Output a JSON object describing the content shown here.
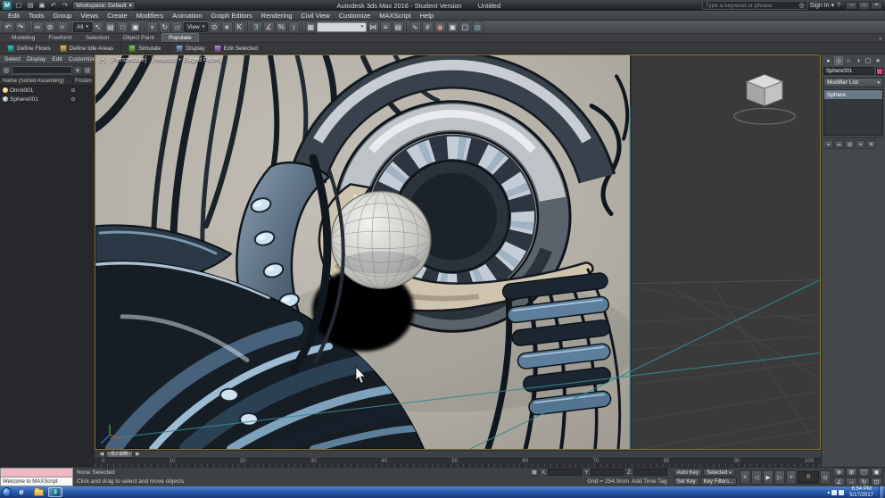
{
  "titlebar": {
    "workspace_label": "Workspace: Default",
    "title": "Autodesk 3ds Max 2016 - Student Version",
    "file_name": "Untitled",
    "search_placeholder": "Type a keyword or phrase",
    "sign_in": "Sign In"
  },
  "menus": {
    "items": [
      "Edit",
      "Tools",
      "Group",
      "Views",
      "Create",
      "Modifiers",
      "Animation",
      "Graph Editors",
      "Rendering",
      "Civil View",
      "Customize",
      "MAXScript",
      "Help"
    ]
  },
  "toolbar": {
    "filter_value": "All",
    "coord_value": "View"
  },
  "ribbon": {
    "tabs": [
      "Modeling",
      "Freeform",
      "Selection",
      "Object Paint",
      "Populate"
    ],
    "tools": [
      "Define Flows",
      "Define Idle Areas",
      "Simulate",
      "Display",
      "Edit Selected"
    ]
  },
  "explorer": {
    "menu": [
      "Select",
      "Display",
      "Edit",
      "Customize"
    ],
    "name_column": "Name (Sorted Ascending)",
    "frozen_column": "Frozen",
    "rows": [
      {
        "name": "Omni001"
      },
      {
        "name": "Sphere001"
      }
    ]
  },
  "viewport": {
    "label_plus": "[+]",
    "label_view": "[Perspective]",
    "label_shading": "[Realistic + Edged Faces]"
  },
  "command_panel": {
    "object_name": "Sphere001",
    "modifier_list": "Modifier List",
    "stack_item": "Sphere"
  },
  "timeline": {
    "slider_label": "0 / 100",
    "ticks": [
      "0",
      "10",
      "20",
      "30",
      "40",
      "50",
      "60",
      "70",
      "80",
      "90",
      "100"
    ]
  },
  "status": {
    "listener_text": "Welcome to MAXScript",
    "selection": "None Selected",
    "prompt": "Click and drag to select and move objects",
    "x_label": "X:",
    "y_label": "Y:",
    "z_label": "Z:",
    "grid": "Grid = 254.0mm",
    "add_time_tag": "Add Time Tag",
    "auto_key": "Auto Key",
    "set_key": "Set Key",
    "selected": "Selected",
    "key_filters": "Key Filters...",
    "frame": "0"
  },
  "taskbar": {
    "time": "6:54 PM",
    "date": "5/17/2017"
  },
  "icons": {
    "caret": "▾",
    "app_logo": "M",
    "new_doc": "▢",
    "open_folder": "▤",
    "save": "▣",
    "undo": "↶",
    "redo": "↷",
    "search": "◎",
    "help": "?",
    "min": "–",
    "max": "□",
    "close": "×",
    "link": "∞",
    "unlink": "⊘",
    "bind": "≈",
    "select_object": "↖",
    "select_by_name": "▤",
    "region": "□",
    "crossing": "▣",
    "move": "+",
    "rotate": "↻",
    "scale": "▱",
    "use_center": "⊙",
    "manipulate": "∗",
    "kbd": "K",
    "snap": "3",
    "angle_snap": "∠",
    "percent_snap": "%",
    "spinner_snap": "↕",
    "named_sets": "▦",
    "mirror": "⋈",
    "align": "≡",
    "layers": "▤",
    "curve_editor": "∿",
    "schematic": "#",
    "material": "◉",
    "render_setup": "▣",
    "render_frame": "▢",
    "render": "◎",
    "explorer_filter": "▾",
    "explorer_lock": "⊡",
    "tab_create": "▸",
    "tab_modify": "◎",
    "tab_hierarchy": "⌂",
    "tab_motion": "◑",
    "tab_display": "▢",
    "tab_utils": "∗",
    "pin_stack": "▪",
    "show_end_result": "∞",
    "make_unique": "⊘",
    "remove_modifier": "×",
    "configure": "≡",
    "slider_prev": "◀",
    "slider_next": "▶",
    "lock": "⊠",
    "go_start": "«",
    "prev_frame": "◁",
    "play": "▶",
    "next_frame": "▷",
    "go_end": "»",
    "time_config": "⊙",
    "nav_zoom": "⊕",
    "nav_zoom_all": "⊞",
    "nav_extents": "▢",
    "nav_extents_all": "▣",
    "nav_fov": "∠",
    "nav_pan": "⇔",
    "nav_orbit": "↻",
    "nav_maximize": "⊡",
    "ie": "e",
    "max_logo": "3",
    "tray_up": "▴"
  },
  "colors": {
    "object_pink": "#df3f98",
    "viewport_grid_teal": "#3a9da0",
    "taskbar_blue": "#2b5cab"
  }
}
